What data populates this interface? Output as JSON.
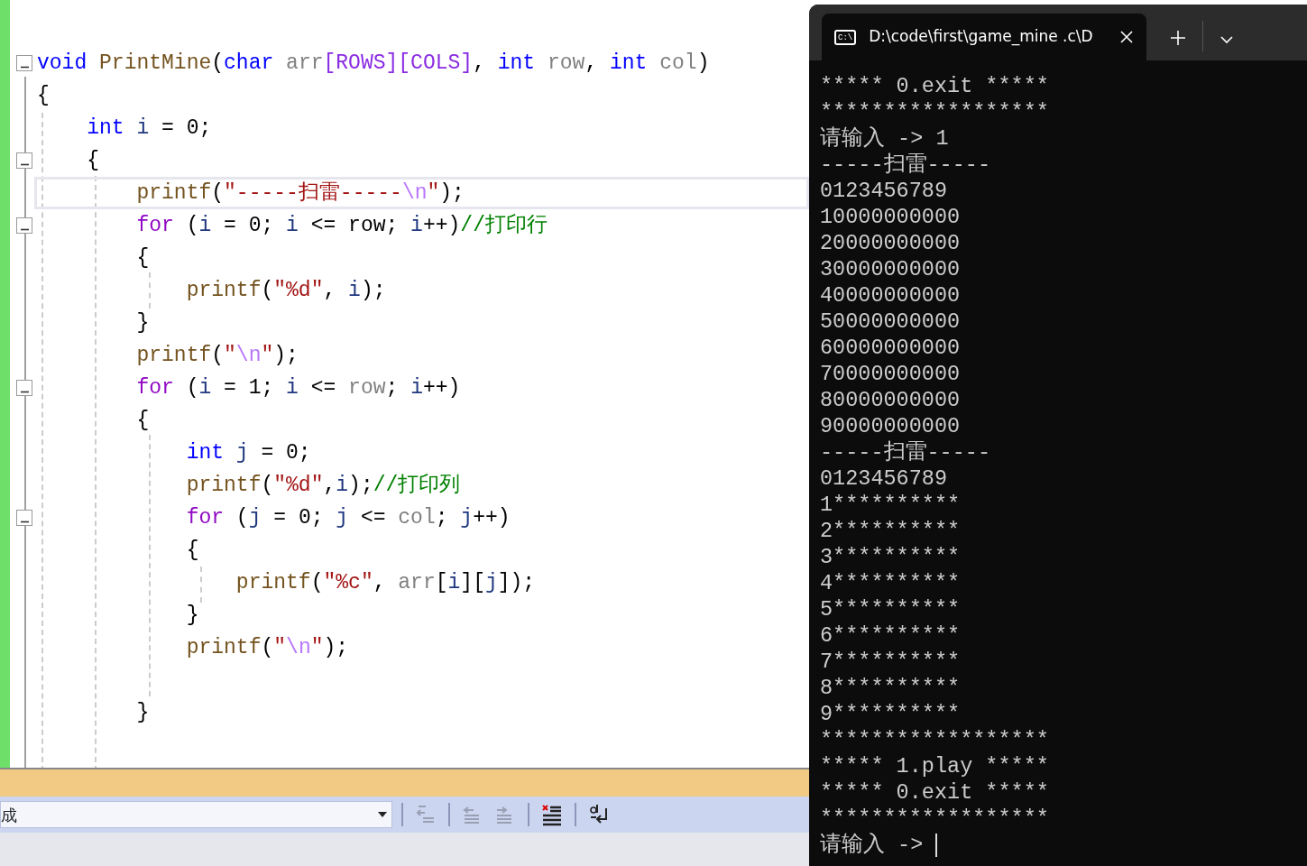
{
  "editor": {
    "lines": [
      {
        "expanded": true,
        "tokens": [
          {
            "text": "void",
            "kind": "keyword"
          },
          {
            "text": " PrintMine",
            "kind": "function"
          },
          {
            "text": "(",
            "kind": "plain"
          },
          {
            "text": "char",
            "kind": "keyword"
          },
          {
            "text": " arr",
            "kind": "param"
          },
          {
            "text": "[ROWS][COLS]",
            "kind": "macro"
          },
          {
            "text": ",",
            "kind": "plain"
          },
          {
            "text": " int",
            "kind": "keyword"
          },
          {
            "text": " row",
            "kind": "param"
          },
          {
            "text": ",",
            "kind": "plain"
          },
          {
            "text": " int",
            "kind": "keyword"
          },
          {
            "text": " col",
            "kind": "param"
          },
          {
            "text": ")",
            "kind": "plain"
          }
        ]
      },
      {
        "tokens": [
          {
            "text": "{",
            "kind": "plain"
          }
        ]
      },
      {
        "tokens": [
          {
            "text": "    int",
            "kind": "keyword"
          },
          {
            "text": " i",
            "kind": "local"
          },
          {
            "text": " = 0;",
            "kind": "plain"
          }
        ]
      },
      {
        "expanded": true,
        "tokens": [
          {
            "text": "    {",
            "kind": "plain"
          }
        ]
      },
      {
        "current": true,
        "tokens": [
          {
            "text": "        printf",
            "kind": "function"
          },
          {
            "text": "(",
            "kind": "plain"
          },
          {
            "text": "\"-----扫雷-----",
            "kind": "string"
          },
          {
            "text": "\\n",
            "kind": "escape"
          },
          {
            "text": "\"",
            "kind": "string"
          },
          {
            "text": ");",
            "kind": "plain"
          }
        ]
      },
      {
        "expanded": true,
        "tokens": [
          {
            "text": "        for",
            "kind": "control"
          },
          {
            "text": " (",
            "kind": "plain"
          },
          {
            "text": "i",
            "kind": "local"
          },
          {
            "text": " = 0;",
            "kind": "plain"
          },
          {
            "text": " i",
            "kind": "local"
          },
          {
            "text": " <= row;",
            "kind": "plain"
          },
          {
            "text": " i",
            "kind": "local"
          },
          {
            "text": "++)",
            "kind": "plain"
          },
          {
            "text": "//打印行",
            "kind": "comment"
          }
        ]
      },
      {
        "tokens": [
          {
            "text": "        {",
            "kind": "plain"
          }
        ]
      },
      {
        "tokens": [
          {
            "text": "            printf",
            "kind": "function"
          },
          {
            "text": "(",
            "kind": "plain"
          },
          {
            "text": "\"%d\"",
            "kind": "string"
          },
          {
            "text": ",",
            "kind": "plain"
          },
          {
            "text": " i",
            "kind": "local"
          },
          {
            "text": ");",
            "kind": "plain"
          }
        ]
      },
      {
        "tokens": [
          {
            "text": "        }",
            "kind": "plain"
          }
        ]
      },
      {
        "tokens": [
          {
            "text": "        printf",
            "kind": "function"
          },
          {
            "text": "(",
            "kind": "plain"
          },
          {
            "text": "\"",
            "kind": "string"
          },
          {
            "text": "\\n",
            "kind": "escape"
          },
          {
            "text": "\"",
            "kind": "string"
          },
          {
            "text": ");",
            "kind": "plain"
          }
        ]
      },
      {
        "expanded": true,
        "tokens": [
          {
            "text": "        for",
            "kind": "control"
          },
          {
            "text": " (",
            "kind": "plain"
          },
          {
            "text": "i",
            "kind": "local"
          },
          {
            "text": " = 1;",
            "kind": "plain"
          },
          {
            "text": " i",
            "kind": "local"
          },
          {
            "text": " <=",
            "kind": "plain"
          },
          {
            "text": " row",
            "kind": "param"
          },
          {
            "text": ";",
            "kind": "plain"
          },
          {
            "text": " i",
            "kind": "local"
          },
          {
            "text": "++)",
            "kind": "plain"
          }
        ]
      },
      {
        "tokens": [
          {
            "text": "        {",
            "kind": "plain"
          }
        ]
      },
      {
        "tokens": [
          {
            "text": "            int",
            "kind": "keyword"
          },
          {
            "text": " j",
            "kind": "local"
          },
          {
            "text": " = 0;",
            "kind": "plain"
          }
        ]
      },
      {
        "tokens": [
          {
            "text": "            printf",
            "kind": "function"
          },
          {
            "text": "(",
            "kind": "plain"
          },
          {
            "text": "\"%d\"",
            "kind": "string"
          },
          {
            "text": ",",
            "kind": "plain"
          },
          {
            "text": "i",
            "kind": "local"
          },
          {
            "text": ");",
            "kind": "plain"
          },
          {
            "text": "//打印列",
            "kind": "comment"
          }
        ]
      },
      {
        "expanded": true,
        "tokens": [
          {
            "text": "            for",
            "kind": "control"
          },
          {
            "text": " (",
            "kind": "plain"
          },
          {
            "text": "j",
            "kind": "local"
          },
          {
            "text": " = 0;",
            "kind": "plain"
          },
          {
            "text": " j",
            "kind": "local"
          },
          {
            "text": " <=",
            "kind": "plain"
          },
          {
            "text": " col",
            "kind": "param"
          },
          {
            "text": ";",
            "kind": "plain"
          },
          {
            "text": " j",
            "kind": "local"
          },
          {
            "text": "++)",
            "kind": "plain"
          }
        ]
      },
      {
        "tokens": [
          {
            "text": "            {",
            "kind": "plain"
          }
        ]
      },
      {
        "tokens": [
          {
            "text": "                printf",
            "kind": "function"
          },
          {
            "text": "(",
            "kind": "plain"
          },
          {
            "text": "\"%c\"",
            "kind": "string"
          },
          {
            "text": ",",
            "kind": "plain"
          },
          {
            "text": " arr",
            "kind": "param"
          },
          {
            "text": "[",
            "kind": "plain"
          },
          {
            "text": "i",
            "kind": "local"
          },
          {
            "text": "][",
            "kind": "plain"
          },
          {
            "text": "j",
            "kind": "local"
          },
          {
            "text": "]);",
            "kind": "plain"
          }
        ]
      },
      {
        "tokens": [
          {
            "text": "            }",
            "kind": "plain"
          }
        ]
      },
      {
        "tokens": [
          {
            "text": "            printf",
            "kind": "function"
          },
          {
            "text": "(",
            "kind": "plain"
          },
          {
            "text": "\"",
            "kind": "string"
          },
          {
            "text": "\\n",
            "kind": "escape"
          },
          {
            "text": "\"",
            "kind": "string"
          },
          {
            "text": ");",
            "kind": "plain"
          }
        ]
      },
      {
        "gap_before": true,
        "tokens": [
          {
            "text": "        }",
            "kind": "plain"
          }
        ]
      }
    ]
  },
  "toolbar": {
    "dropdown": {
      "value": "成"
    },
    "buttons": [
      {
        "kind": "outdent-single",
        "disabled": true
      },
      {
        "kind": "outdent",
        "disabled": true
      },
      {
        "kind": "indent",
        "disabled": true
      },
      {
        "kind": "clear",
        "disabled": false
      },
      {
        "kind": "wrap",
        "disabled": false
      }
    ]
  },
  "terminal": {
    "tab": {
      "icon_label": "C:\\",
      "title": "D:\\code\\first\\game_mine .c\\D",
      "selected": true
    },
    "lines": [
      "***** 0.exit *****",
      "******************",
      "请输入 -> 1",
      "-----扫雷-----",
      "0123456789",
      "10000000000",
      "20000000000",
      "30000000000",
      "40000000000",
      "50000000000",
      "60000000000",
      "70000000000",
      "80000000000",
      "90000000000",
      "-----扫雷-----",
      "0123456789",
      "1**********",
      "2**********",
      "3**********",
      "4**********",
      "5**********",
      "6**********",
      "7**********",
      "8**********",
      "9**********",
      "******************",
      "***** 1.play *****",
      "***** 0.exit *****",
      "******************"
    ],
    "prompt": "请输入 -> "
  }
}
